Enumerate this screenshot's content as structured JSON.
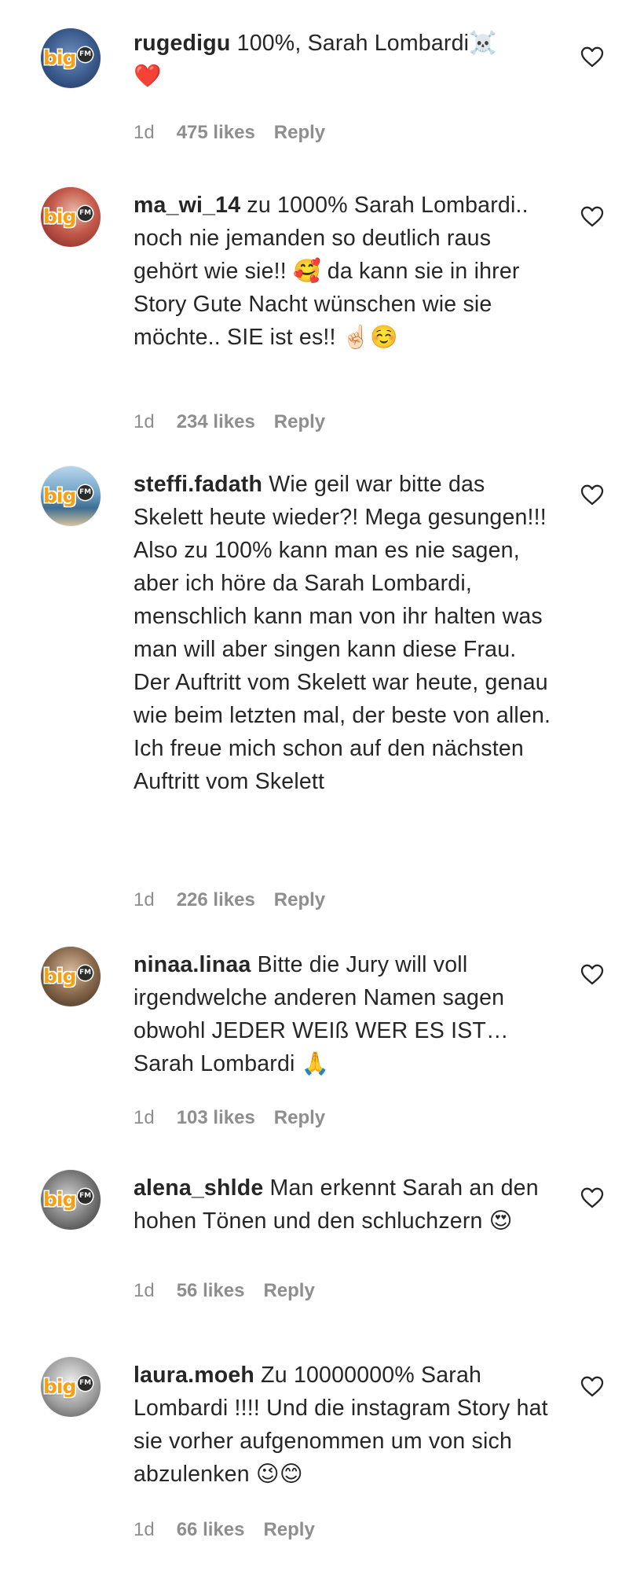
{
  "comments": [
    {
      "username": "rugedigu",
      "text": "100%, Sarah Lombardi☠️\n❤️",
      "time": "1d",
      "likes": "475 likes",
      "reply": "Reply",
      "avatar_bg": "#3a5a8c"
    },
    {
      "username": "ma_wi_14",
      "text": "zu 1000% Sarah Lombardi.. noch nie jemanden so deutlich raus gehört wie sie!! 🥰 da kann sie in ihrer Story Gute Nacht wünschen wie sie möchte.. SIE ist es!! ☝🏻☺️",
      "time": "1d",
      "likes": "234 likes",
      "reply": "Reply",
      "avatar_bg": "#b8483c"
    },
    {
      "username": "steffi.fadath",
      "text": "Wie geil war bitte das Skelett heute wieder?! Mega gesungen!!! Also zu 100% kann man es nie sagen, aber ich höre da Sarah Lombardi, menschlich kann man von ihr halten was man will aber singen kann diese Frau.\nDer Auftritt vom Skelett war heute, genau wie beim letzten mal, der beste von allen.\nIch freue mich schon auf den nächsten Auftritt vom Skelett",
      "time": "1d",
      "likes": "226 likes",
      "reply": "Reply",
      "avatar_bg": "#6fa3c8"
    },
    {
      "username": "ninaa.linaa",
      "text": "Bitte die Jury will voll irgendwelche anderen Namen sagen obwohl JEDER WEIß WER ES IST… Sarah Lombardi 🙏",
      "time": "1d",
      "likes": "103 likes",
      "reply": "Reply",
      "avatar_bg": "#8a6a4e"
    },
    {
      "username": "alena_shlde",
      "text": "Man erkennt Sarah an den hohen Tönen und den schluchzern 😍",
      "time": "1d",
      "likes": "56 likes",
      "reply": "Reply",
      "avatar_bg": "#7d7d7d"
    },
    {
      "username": "laura.moeh",
      "text": "Zu 10000000% Sarah Lombardi !!!! Und die instagram Story hat sie vorher aufgenommen um von sich abzulenken 😉😊",
      "time": "1d",
      "likes": "66 likes",
      "reply": "Reply",
      "avatar_bg": "#a0a0a0"
    }
  ],
  "avatar_logo": {
    "big": "big",
    "fm": "FM"
  },
  "colors": {
    "text": "#262626",
    "meta": "#8e8e8e",
    "logo_orange": "#f7a014"
  },
  "icons": {
    "like": "heart-outline-icon"
  }
}
